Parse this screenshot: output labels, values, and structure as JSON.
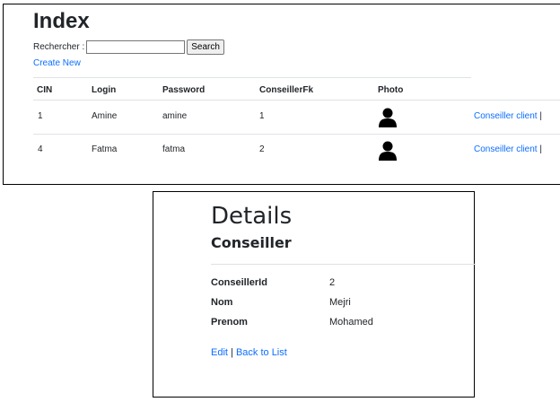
{
  "index": {
    "title": "Index",
    "search_label": "Rechercher :",
    "search_value": "",
    "search_button": "Search",
    "create_new": "Create New",
    "columns": [
      "CIN",
      "Login",
      "Password",
      "ConseillerFk",
      "Photo"
    ],
    "rows": [
      {
        "cin": "1",
        "login": "Amine",
        "password": "amine",
        "conseiller_fk": "1",
        "photo": "user-silhouette-icon",
        "action": "Conseiller client",
        "action_sep": "|"
      },
      {
        "cin": "4",
        "login": "Fatma",
        "password": "fatma",
        "conseiller_fk": "2",
        "photo": "user-silhouette-icon",
        "action": "Conseiller client",
        "action_sep": "|"
      }
    ]
  },
  "details": {
    "title": "Details",
    "subtitle": "Conseiller",
    "fields": [
      {
        "label": "ConseillerId",
        "value": "2"
      },
      {
        "label": "Nom",
        "value": "Mejri"
      },
      {
        "label": "Prenom",
        "value": "Mohamed"
      }
    ],
    "edit_link": "Edit",
    "separator": "|",
    "back_link": "Back to List"
  },
  "colors": {
    "link": "#0d6efd",
    "text": "#212529",
    "divider": "#dee2e6"
  }
}
